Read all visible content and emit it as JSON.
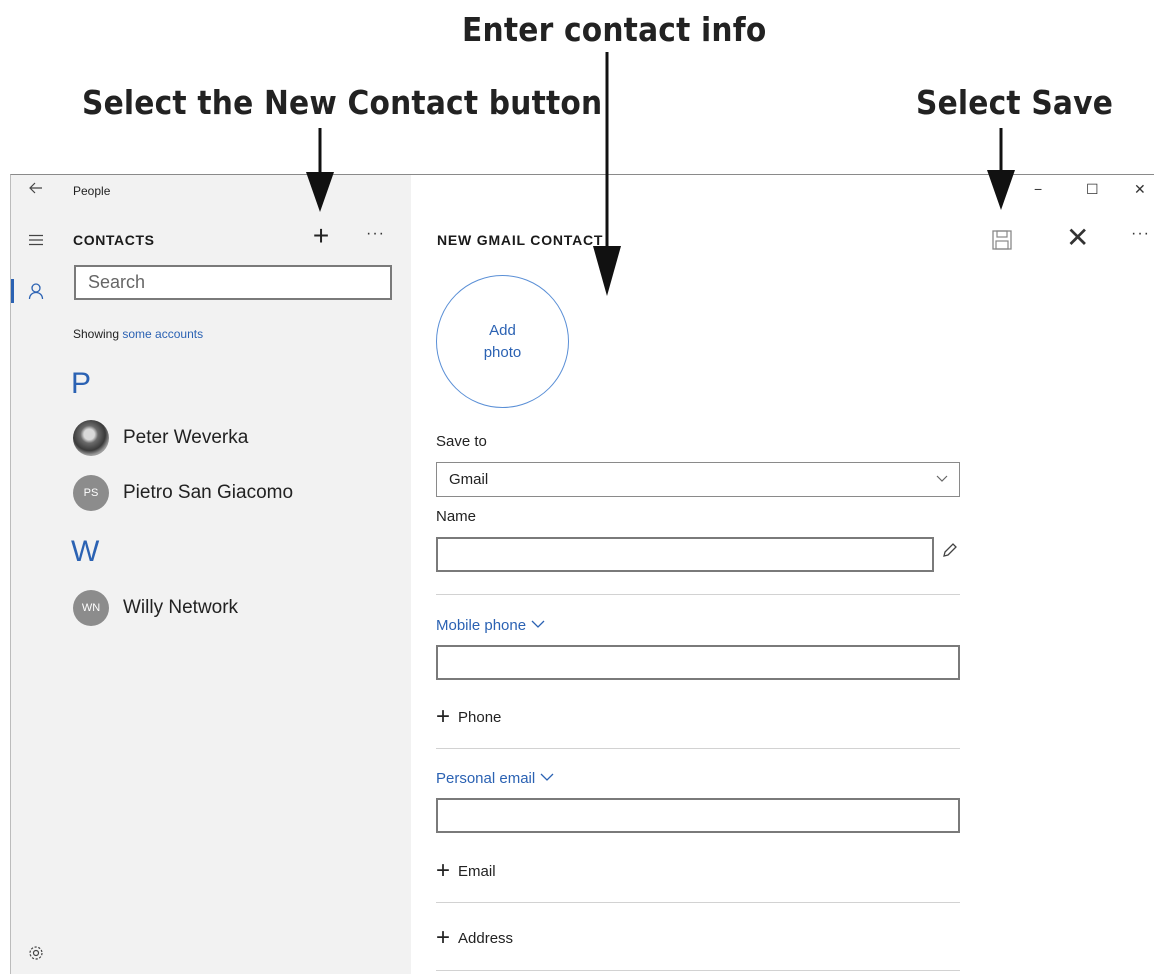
{
  "callouts": {
    "enter_contact_info": "Enter contact info",
    "new_contact": "Select the New Contact button",
    "save": "Select Save"
  },
  "window": {
    "app_title": "People",
    "controls": [
      "−",
      "☐",
      "✕"
    ]
  },
  "rail": {
    "icons": [
      "back-arrow-icon",
      "hamburger-menu-icon",
      "person-icon",
      "settings-gear-icon"
    ]
  },
  "contacts_pane": {
    "title": "CONTACTS",
    "add_label": "+",
    "more_label": "···",
    "search_placeholder": "Search",
    "showing_prefix": "Showing",
    "showing_link": "some accounts",
    "groups": [
      {
        "letter": "P",
        "contacts": [
          {
            "name": "Peter Weverka",
            "initials": "",
            "photo": true
          },
          {
            "name": "Pietro San Giacomo",
            "initials": "PS",
            "photo": false
          }
        ]
      },
      {
        "letter": "W",
        "contacts": [
          {
            "name": "Willy Network",
            "initials": "WN",
            "photo": false
          }
        ]
      }
    ]
  },
  "detail_pane": {
    "title": "NEW GMAIL CONTACT",
    "close_label": "✕",
    "more_label": "···",
    "add_photo_line1": "Add",
    "add_photo_line2": "photo",
    "save_to_label": "Save to",
    "save_to_value": "Gmail",
    "name_label": "Name",
    "name_value": "",
    "mobile_phone_label": "Mobile phone",
    "mobile_phone_value": "",
    "add_phone_label": "Phone",
    "personal_email_label": "Personal email",
    "personal_email_value": "",
    "add_email_label": "Email",
    "add_address_label": "Address"
  },
  "colors": {
    "accent": "#2b62b3",
    "pane_bg": "#f2f2f2",
    "avatar_bg": "#8c8c8c"
  }
}
